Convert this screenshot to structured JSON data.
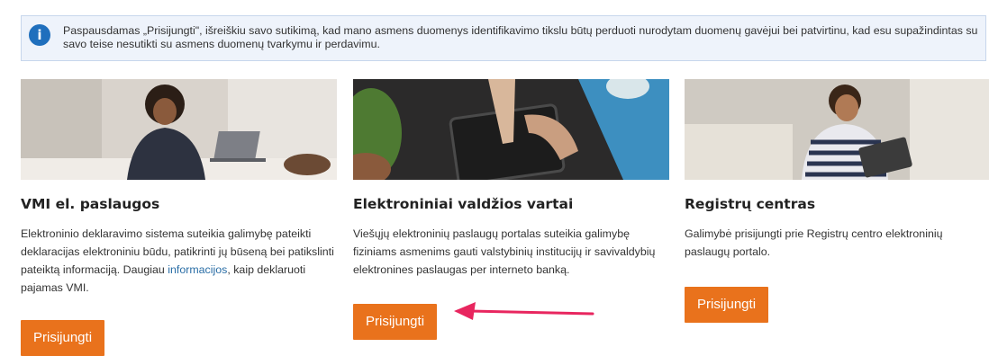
{
  "notice": {
    "icon": "info-icon",
    "text": "Paspausdamas „Prisijungti\", išreiškiu savo sutikimą, kad mano asmens duomenys identifikavimo tikslu būtų perduoti nurodytam duomenų gavėjui bei patvirtinu, kad esu supažindintas su savo teise nesutikti su asmens duomenų tvarkymu ir perdavimu."
  },
  "cards": [
    {
      "title": "VMI el. paslaugos",
      "desc_before": "Elektroninio deklaravimo sistema suteikia galimybę pateikti deklaracijas elektroniniu būdu, patikrinti jų būseną bei patikslinti pateiktą informaciją. Daugiau ",
      "link": "informacijos",
      "desc_after": ", kaip deklaruoti pajamas VMI.",
      "button": "Prisijungti"
    },
    {
      "title": "Elektroniniai valdžios vartai",
      "desc": "Viešųjų elektroninių paslaugų portalas suteikia galimybę fiziniams asmenims gauti valstybinių institucijų ir savivaldybių elektronines paslaugas per interneto banką.",
      "button": "Prisijungti"
    },
    {
      "title": "Registrų centras",
      "desc": "Galimybė prisijungti prie Registrų centro elektroninių paslaugų portalo.",
      "button": "Prisijungti"
    }
  ],
  "colors": {
    "accent": "#e9721c",
    "arrow": "#e8265f",
    "info": "#1f6fbd"
  }
}
